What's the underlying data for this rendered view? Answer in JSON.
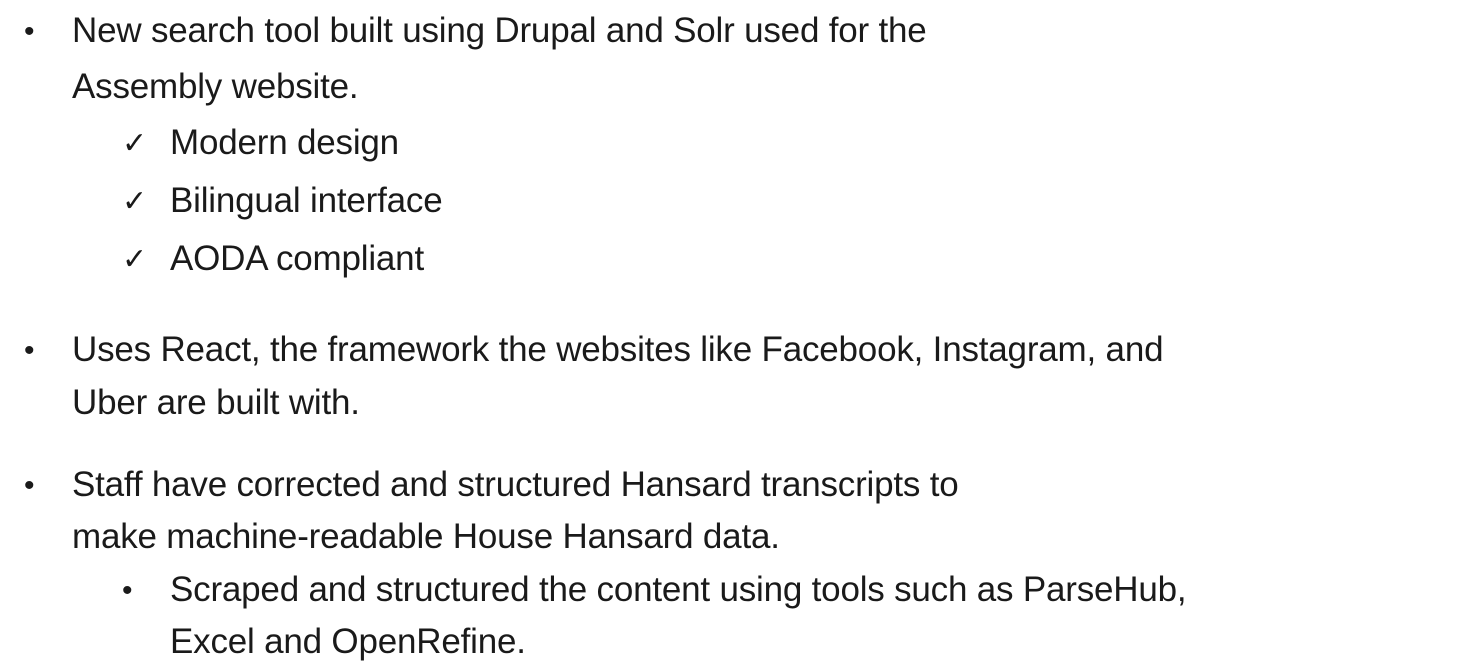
{
  "bullets": [
    {
      "marker": "•",
      "lines": [
        "New search tool built using Drupal and Solr used for the",
        "Assembly website."
      ],
      "checks": [
        {
          "marker": "✓",
          "text": "Modern design"
        },
        {
          "marker": "✓",
          "text": "Bilingual interface"
        },
        {
          "marker": "✓",
          "text": "AODA compliant"
        }
      ]
    },
    {
      "marker": "•",
      "lines": [
        "Uses React, the framework the websites like Facebook, Instagram, and",
        "Uber are built with."
      ]
    },
    {
      "marker": "•",
      "lines": [
        "Staff have corrected and structured Hansard transcripts to",
        "make machine-readable House Hansard data."
      ],
      "sub": [
        {
          "marker": "•",
          "lines": [
            "Scraped and structured the content using tools such as ParseHub,",
            "Excel and OpenRefine."
          ]
        }
      ]
    }
  ]
}
